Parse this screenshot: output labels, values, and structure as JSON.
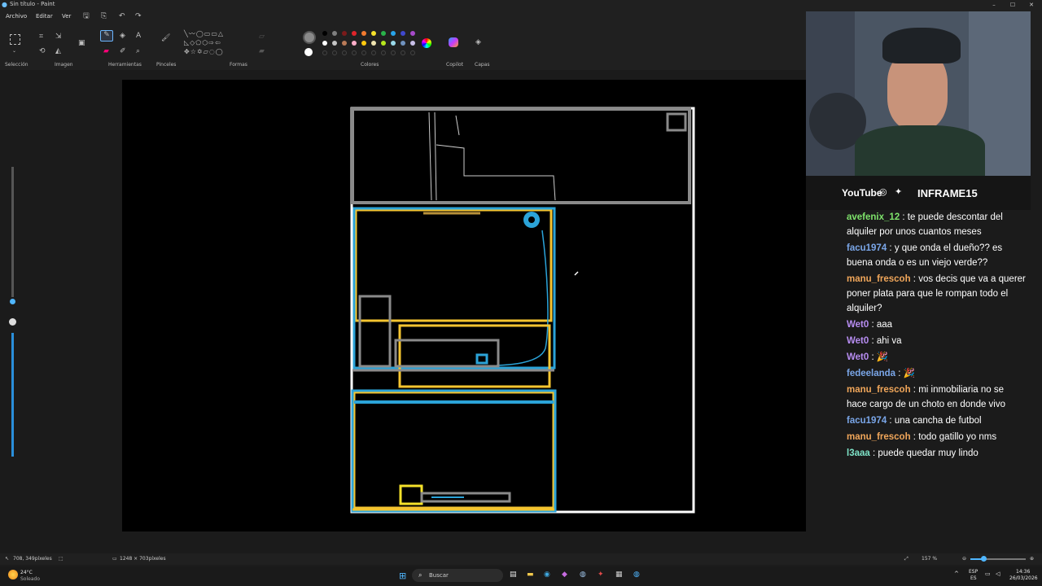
{
  "window": {
    "title": "Sin título - Paint"
  },
  "menu": {
    "file": "Archivo",
    "edit": "Editar",
    "view": "Ver"
  },
  "ribbon": {
    "groups": {
      "selection": "Selección",
      "image": "Imagen",
      "tools": "Herramientas",
      "brushes": "Pinceles",
      "shapes": "Formas",
      "colors": "Colores",
      "copilot": "Copilot",
      "layers": "Capas"
    },
    "colors": {
      "current": "#8a8a8a",
      "secondary": "#ffffff",
      "row1": [
        "#000000",
        "#7f7f7f",
        "#7a1a1a",
        "#e0242a",
        "#f27a2f",
        "#f5e12a",
        "#29b24a",
        "#28a3e8",
        "#3f48cc",
        "#a64ac9"
      ],
      "row2": [
        "#ffffff",
        "#c3c3c3",
        "#b97a57",
        "#ffaec9",
        "#ffc90e",
        "#efe4b0",
        "#b5e61d",
        "#99d9ea",
        "#7092be",
        "#c8bfe7"
      ]
    }
  },
  "status": {
    "cursor": "708, 349píxeles",
    "canvas_size": "1248 × 703píxeles",
    "zoom": "157 %"
  },
  "taskbar": {
    "weather_temp": "24°C",
    "weather_desc": "Soleado",
    "search_placeholder": "Buscar",
    "lang_1": "ESP",
    "lang_2": "ES",
    "time": "14:36",
    "date": "26/03/2026"
  },
  "overlay": {
    "social": {
      "youtube": "YouTube",
      "handle": "INFRAME15"
    },
    "chat": [
      {
        "user": "avefenix_12",
        "color": "#7ee36b",
        "text": ": te puede descontar del alquiler por unos cuantos meses"
      },
      {
        "user": "facu1974",
        "color": "#7aa6e8",
        "text": ": y que onda el dueño?? es buena onda o es un viejo verde??"
      },
      {
        "user": "manu_frescoh",
        "color": "#f0a65a",
        "text": ": vos decis que va a querer poner plata para que le rompan todo el alquiler?"
      },
      {
        "user": "Wet0",
        "color": "#b68cf0",
        "text": ": aaa"
      },
      {
        "user": "Wet0",
        "color": "#b68cf0",
        "text": ": ahi va"
      },
      {
        "user": "Wet0",
        "color": "#b68cf0",
        "text": ": 🎉"
      },
      {
        "user": "fedeelanda",
        "color": "#7aa6e8",
        "text": ": 🎉"
      },
      {
        "user": "manu_frescoh",
        "color": "#f0a65a",
        "text": ": mi inmobiliaria no se hace cargo de un choto en donde vivo"
      },
      {
        "user": "facu1974",
        "color": "#7aa6e8",
        "text": ": una cancha de futbol"
      },
      {
        "user": "manu_frescoh",
        "color": "#f0a65a",
        "text": ": todo gatillo yo nms"
      },
      {
        "user": "l3aaa",
        "color": "#7ee3c8",
        "text": ": puede quedar muy lindo"
      }
    ]
  }
}
